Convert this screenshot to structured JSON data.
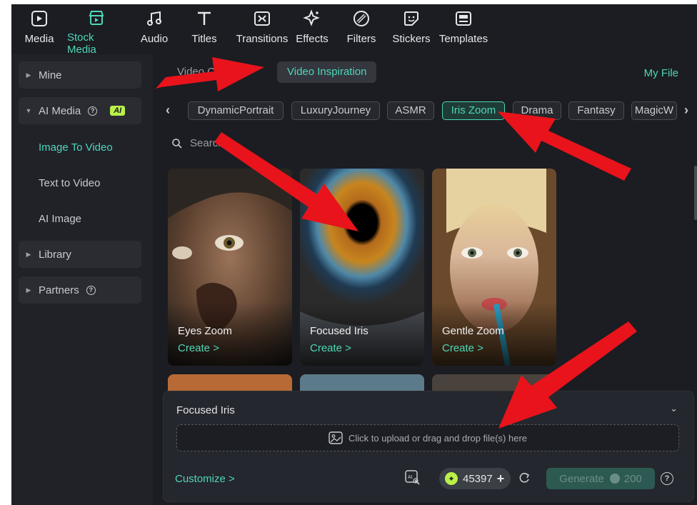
{
  "toolbar": {
    "items": [
      {
        "label": "Media",
        "icon": "media-icon"
      },
      {
        "label": "Stock Media",
        "icon": "stock-media-icon",
        "active": true
      },
      {
        "label": "Audio",
        "icon": "music-note-icon"
      },
      {
        "label": "Titles",
        "icon": "text-t-icon"
      },
      {
        "label": "Transitions",
        "icon": "transitions-icon"
      },
      {
        "label": "Effects",
        "icon": "effects-sparkle-icon"
      },
      {
        "label": "Filters",
        "icon": "filters-icon"
      },
      {
        "label": "Stickers",
        "icon": "sticker-icon"
      },
      {
        "label": "Templates",
        "icon": "templates-icon"
      }
    ]
  },
  "sidebar": {
    "mine": "Mine",
    "ai_media": "AI Media",
    "ai_badge": "AI",
    "sub_items": [
      "Image To Video",
      "Text to Video",
      "AI Image"
    ],
    "library": "Library",
    "partners": "Partners"
  },
  "main": {
    "tab_video_creation": "Video Creation",
    "tab_video_inspiration": "Video Inspiration",
    "my_file": "My File",
    "chips": [
      "DynamicPortrait",
      "LuxuryJourney",
      "ASMR",
      "Iris Zoom",
      "Drama",
      "Fantasy",
      "MagicW"
    ],
    "active_chip": "Iris Zoom",
    "search_placeholder": "Search",
    "cards": [
      {
        "name": "Eyes Zoom",
        "action": "Create >"
      },
      {
        "name": "Focused Iris",
        "action": "Create >",
        "selected": true
      },
      {
        "name": "Gentle Zoom",
        "action": "Create >"
      }
    ]
  },
  "panel": {
    "title": "Focused Iris",
    "upload_text": "Click to upload or drag and drop file(s) here",
    "customize": "Customize >",
    "credits": "45397",
    "generate_label": "Generate",
    "generate_cost": "200"
  },
  "colors": {
    "accent": "#4fd6b8",
    "background": "#1b1d22",
    "ai_badge": "#b9f04a",
    "annotation_arrow": "#e8131b"
  }
}
